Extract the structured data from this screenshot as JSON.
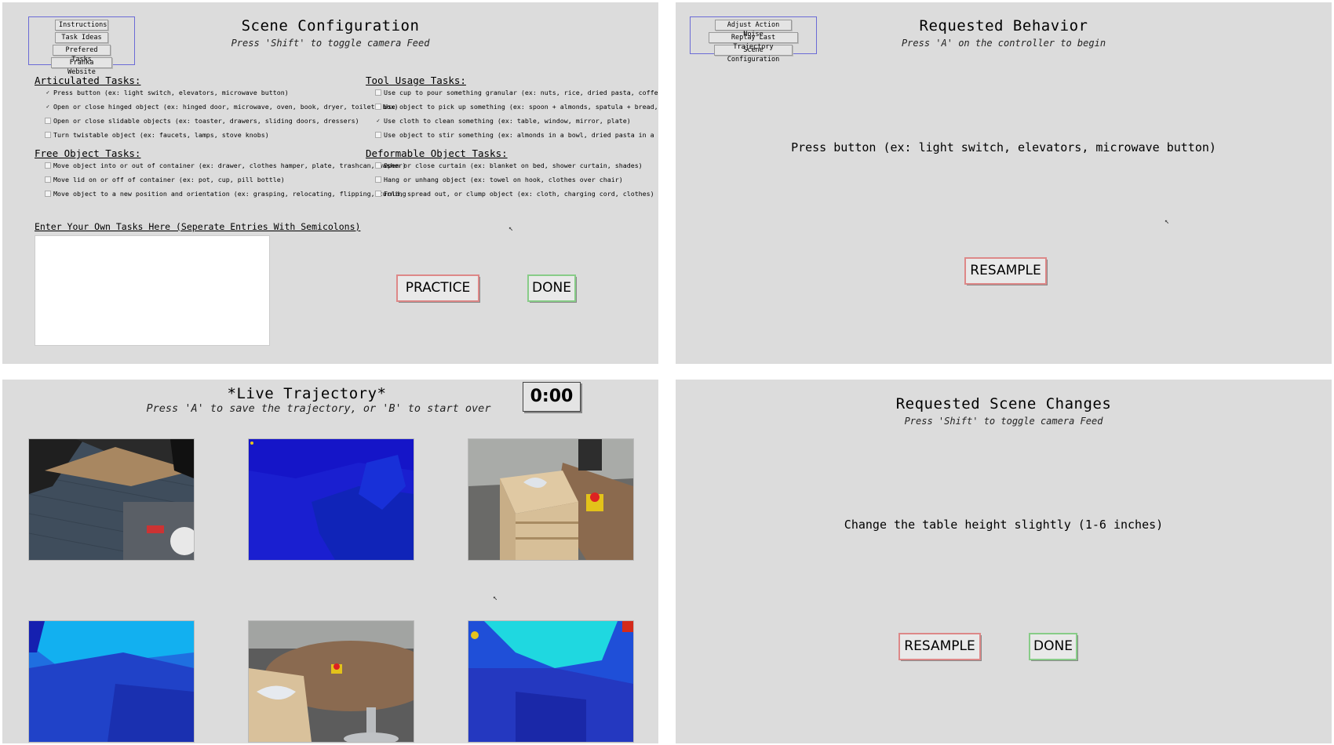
{
  "scene_config": {
    "menu": [
      "Instructions",
      "Task Ideas",
      "Prefered Tasks",
      "Franka Website"
    ],
    "title": "Scene Configuration",
    "subtitle": "Press 'Shift' to toggle camera Feed",
    "articulated": {
      "heading": "Articulated Tasks:",
      "items": [
        {
          "label": "Press button (ex: light switch, elevators, microwave button)",
          "checked": true
        },
        {
          "label": "Open or close hinged object (ex: hinged door, microwave, oven, book, dryer, toilet, box)",
          "checked": true
        },
        {
          "label": "Open or close slidable objects (ex: toaster, drawers, sliding doors, dressers)",
          "checked": false
        },
        {
          "label": "Turn twistable object (ex: faucets, lamps, stove knobs)",
          "checked": false
        }
      ]
    },
    "tool_usage": {
      "heading": "Tool Usage Tasks:",
      "items": [
        {
          "label": "Use cup to pour something granular (ex: nuts, rice, dried pasta, coffee beans)",
          "checked": false
        },
        {
          "label": "Use object to pick up something (ex: spoon + almonds, spatula + bread, fork +",
          "checked": false
        },
        {
          "label": "Use cloth to clean something (ex: table, window, mirror, plate)",
          "checked": true
        },
        {
          "label": "Use object to stir something (ex: almonds in a bowl, dried pasta in a pot)",
          "checked": false
        }
      ]
    },
    "free_object": {
      "heading": "Free Object Tasks:",
      "items": [
        {
          "label": "Move object into or out of container (ex: drawer, clothes hamper, plate, trashcan, washer)",
          "checked": false
        },
        {
          "label": "Move lid on or off of container (ex: pot, cup, pill bottle)",
          "checked": false
        },
        {
          "label": "Move object to a new position and orientation (ex: grasping, relocating, flipping, turning",
          "checked": false
        }
      ]
    },
    "deformable": {
      "heading": "Deformable Object Tasks:",
      "items": [
        {
          "label": "Open or close curtain (ex: blanket on bed, shower curtain, shades)",
          "checked": false
        },
        {
          "label": "Hang or unhang object (ex: towel on hook, clothes over chair)",
          "checked": false
        },
        {
          "label": "Fold, spread out, or clump object (ex: cloth, charging cord, clothes)",
          "checked": false
        }
      ]
    },
    "own_tasks_label": "Enter Your Own Tasks Here (Seperate Entries With Semicolons)",
    "own_tasks_value": "",
    "practice_label": "PRACTICE",
    "done_label": "DONE"
  },
  "requested_behavior": {
    "menu": [
      "Adjust Action Noise",
      "Replay Last Trajectory",
      "Scene Configuration"
    ],
    "title": "Requested Behavior",
    "subtitle": "Press 'A' on the controller to begin",
    "behavior": "Press button (ex: light switch, elevators, microwave button)",
    "resample_label": "RESAMPLE"
  },
  "live_trajectory": {
    "title": "*Live Trajectory*",
    "subtitle": "Press 'A' to save the trajectory, or 'B' to start over",
    "timer": "0:00",
    "feeds": [
      {
        "name": "wrist-rgb-feed",
        "kind": "rgb"
      },
      {
        "name": "wrist-depth-feed",
        "kind": "depth"
      },
      {
        "name": "left-rgb-feed",
        "kind": "rgb"
      },
      {
        "name": "left-depth-feed",
        "kind": "depth"
      },
      {
        "name": "right-rgb-feed",
        "kind": "rgb"
      },
      {
        "name": "right-depth-feed",
        "kind": "depth"
      }
    ]
  },
  "scene_changes": {
    "title": "Requested Scene Changes",
    "subtitle": "Press 'Shift' to toggle camera Feed",
    "change": "Change the table height slightly (1-6 inches)",
    "resample_label": "RESAMPLE",
    "done_label": "DONE"
  }
}
